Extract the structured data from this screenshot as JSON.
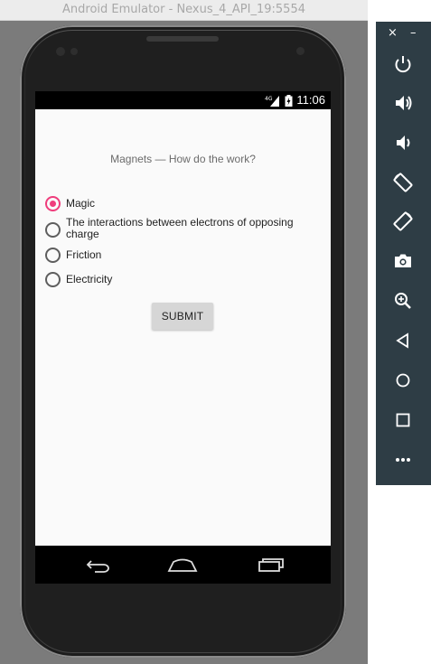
{
  "window": {
    "title": "Android Emulator - Nexus_4_API_19:5554"
  },
  "status_bar": {
    "network": "4G",
    "time": "11:06"
  },
  "quiz": {
    "question": "Magnets — How do the work?",
    "options": [
      {
        "label": "Magic",
        "selected": true
      },
      {
        "label": "The interactions between electrons of opposing charge",
        "selected": false
      },
      {
        "label": "Friction",
        "selected": false
      },
      {
        "label": "Electricity",
        "selected": false
      }
    ],
    "submit_label": "SUBMIT"
  },
  "nav_bar": {
    "icons": [
      "back-icon",
      "home-icon",
      "recents-icon"
    ]
  },
  "toolbar": {
    "close_label": "×",
    "minimize_label": "–",
    "icons": [
      "power-icon",
      "volume-up-icon",
      "volume-down-icon",
      "rotate-left-icon",
      "rotate-right-icon",
      "camera-icon",
      "zoom-icon",
      "back-icon",
      "home-icon",
      "overview-icon",
      "more-icon"
    ]
  },
  "colors": {
    "accent": "#ef3d7c",
    "toolbar_bg": "#2e3d45",
    "screen_bg": "#fafafa"
  }
}
